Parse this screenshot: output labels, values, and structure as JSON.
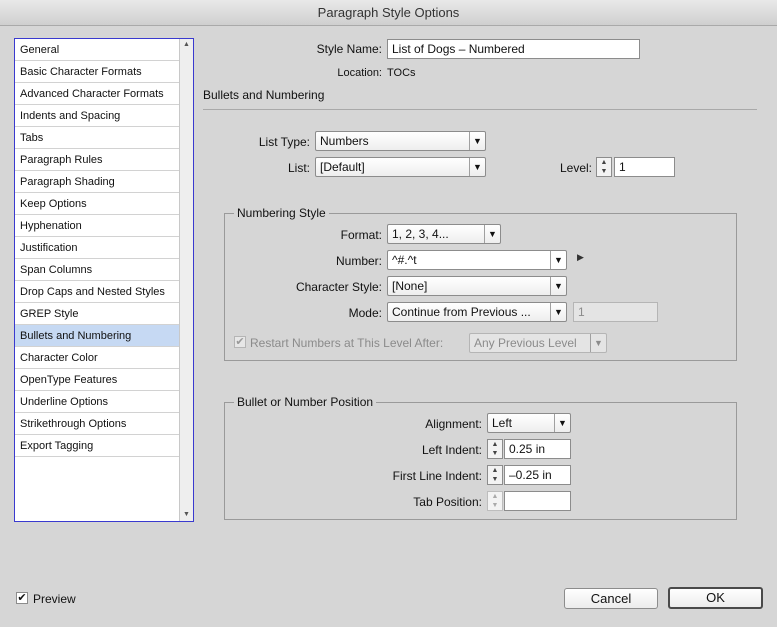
{
  "window": {
    "title": "Paragraph Style Options"
  },
  "sidebar": {
    "items": [
      "General",
      "Basic Character Formats",
      "Advanced Character Formats",
      "Indents and Spacing",
      "Tabs",
      "Paragraph Rules",
      "Paragraph Shading",
      "Keep Options",
      "Hyphenation",
      "Justification",
      "Span Columns",
      "Drop Caps and Nested Styles",
      "GREP Style",
      "Bullets and Numbering",
      "Character Color",
      "OpenType Features",
      "Underline Options",
      "Strikethrough Options",
      "Export Tagging"
    ],
    "selected_index": 13
  },
  "header": {
    "style_name_label": "Style Name:",
    "style_name_value": "List of Dogs – Numbered",
    "location_label": "Location:",
    "location_value": "TOCs",
    "section_title": "Bullets and Numbering"
  },
  "list_settings": {
    "list_type_label": "List Type:",
    "list_type_value": "Numbers",
    "list_label": "List:",
    "list_value": "[Default]",
    "level_label": "Level:",
    "level_value": "1"
  },
  "numbering_style": {
    "title": "Numbering Style",
    "format_label": "Format:",
    "format_value": "1, 2, 3, 4...",
    "number_label": "Number:",
    "number_value": "^#.^t",
    "character_style_label": "Character Style:",
    "character_style_value": "[None]",
    "mode_label": "Mode:",
    "mode_value": "Continue from Previous ...",
    "mode_start_value": "1",
    "restart_label": "Restart Numbers at This Level After:",
    "restart_checked": true,
    "restart_value": "Any Previous Level"
  },
  "position": {
    "title": "Bullet or Number Position",
    "alignment_label": "Alignment:",
    "alignment_value": "Left",
    "left_indent_label": "Left Indent:",
    "left_indent_value": "0.25 in",
    "first_line_indent_label": "First Line Indent:",
    "first_line_indent_value": "–0.25 in",
    "tab_position_label": "Tab Position:",
    "tab_position_value": ""
  },
  "footer": {
    "preview_label": "Preview",
    "preview_checked": true,
    "cancel_label": "Cancel",
    "ok_label": "OK"
  },
  "glyphs": {
    "check": "✔",
    "dropdown": "▼",
    "step_up": "▲",
    "step_down": "▼",
    "play": "▶"
  }
}
